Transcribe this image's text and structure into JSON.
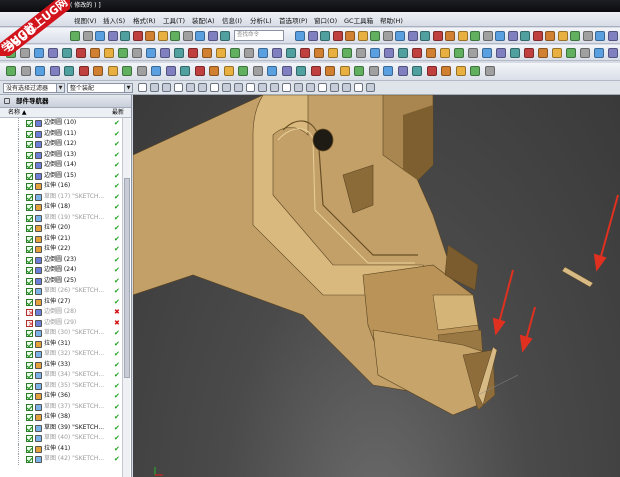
{
  "titlebar": {
    "text": "( 修改的 ) ]"
  },
  "watermark": {
    "top": "9SUG",
    "band": "学UG就上UG网"
  },
  "menu": {
    "items": [
      "视图(V)",
      "插入(S)",
      "格式(R)",
      "工具(T)",
      "装配(A)",
      "信息(I)",
      "分析(L)",
      "首选项(P)",
      "窗口(O)",
      "GC工具箱",
      "帮助(H)"
    ]
  },
  "toolbar": {
    "search_placeholder": "查找命令"
  },
  "selbar": {
    "filter": "没有选择过滤器",
    "scope": "整个装配"
  },
  "navigator": {
    "title": "部件导航器",
    "col_name": "名称",
    "col_latest": "最新",
    "rows": [
      {
        "label": "边倒圆 (10)",
        "type": "blend",
        "ok": true,
        "dim": false
      },
      {
        "label": "边倒圆 (11)",
        "type": "blend",
        "ok": true,
        "dim": false
      },
      {
        "label": "边倒圆 (12)",
        "type": "blend",
        "ok": true,
        "dim": false
      },
      {
        "label": "边倒圆 (13)",
        "type": "blend",
        "ok": true,
        "dim": false
      },
      {
        "label": "边倒圆 (14)",
        "type": "blend",
        "ok": true,
        "dim": false
      },
      {
        "label": "边倒圆 (15)",
        "type": "blend",
        "ok": true,
        "dim": false
      },
      {
        "label": "拉伸 (16)",
        "type": "extrude",
        "ok": true,
        "dim": false
      },
      {
        "label": "草图 (17) \"SKETCH...",
        "type": "sketch",
        "ok": true,
        "dim": true
      },
      {
        "label": "拉伸 (18)",
        "type": "extrude",
        "ok": true,
        "dim": false
      },
      {
        "label": "草图 (19) \"SKETCH...",
        "type": "sketch",
        "ok": true,
        "dim": true
      },
      {
        "label": "拉伸 (20)",
        "type": "extrude",
        "ok": true,
        "dim": false
      },
      {
        "label": "拉伸 (21)",
        "type": "extrude",
        "ok": true,
        "dim": false
      },
      {
        "label": "拉伸 (22)",
        "type": "extrude",
        "ok": true,
        "dim": false
      },
      {
        "label": "边倒圆 (23)",
        "type": "blend",
        "ok": true,
        "dim": false
      },
      {
        "label": "边倒圆 (24)",
        "type": "blend",
        "ok": true,
        "dim": false
      },
      {
        "label": "边倒圆 (25)",
        "type": "blend",
        "ok": true,
        "dim": false
      },
      {
        "label": "草图 (26) \"SKETCH...",
        "type": "sketch",
        "ok": true,
        "dim": true
      },
      {
        "label": "拉伸 (27)",
        "type": "extrude",
        "ok": true,
        "dim": false
      },
      {
        "label": "边倒圆 (28)",
        "type": "blend",
        "ok": false,
        "dim": true
      },
      {
        "label": "边倒圆 (29)",
        "type": "blend",
        "ok": false,
        "dim": true
      },
      {
        "label": "草图 (30) \"SKETCH...",
        "type": "sketch",
        "ok": true,
        "dim": true
      },
      {
        "label": "拉伸 (31)",
        "type": "extrude",
        "ok": true,
        "dim": false
      },
      {
        "label": "草图 (32) \"SKETCH...",
        "type": "sketch",
        "ok": true,
        "dim": true
      },
      {
        "label": "拉伸 (33)",
        "type": "extrude",
        "ok": true,
        "dim": false
      },
      {
        "label": "草图 (34) \"SKETCH...",
        "type": "sketch",
        "ok": true,
        "dim": true
      },
      {
        "label": "草图 (35) \"SKETCH...",
        "type": "sketch",
        "ok": true,
        "dim": true
      },
      {
        "label": "拉伸 (36)",
        "type": "extrude",
        "ok": true,
        "dim": false
      },
      {
        "label": "草图 (37) \"SKETCH...",
        "type": "sketch",
        "ok": true,
        "dim": true
      },
      {
        "label": "拉伸 (38)",
        "type": "extrude",
        "ok": true,
        "dim": false
      },
      {
        "label": "草图 (39) \"SKETCH...",
        "type": "sketch",
        "ok": true,
        "dim": false
      },
      {
        "label": "草图 (40) \"SKETCH...",
        "type": "sketch",
        "ok": true,
        "dim": true
      },
      {
        "label": "拉伸 (41)",
        "type": "extrude",
        "ok": true,
        "dim": false
      },
      {
        "label": "草图 (42) \"SKETCH...",
        "type": "sketch",
        "ok": true,
        "dim": true
      }
    ]
  },
  "colors": {
    "part": "#c8a468",
    "part_dark": "#8d6b3a",
    "arrow": "#e03020",
    "ok": "#1aa01a",
    "bad": "#d01010"
  }
}
